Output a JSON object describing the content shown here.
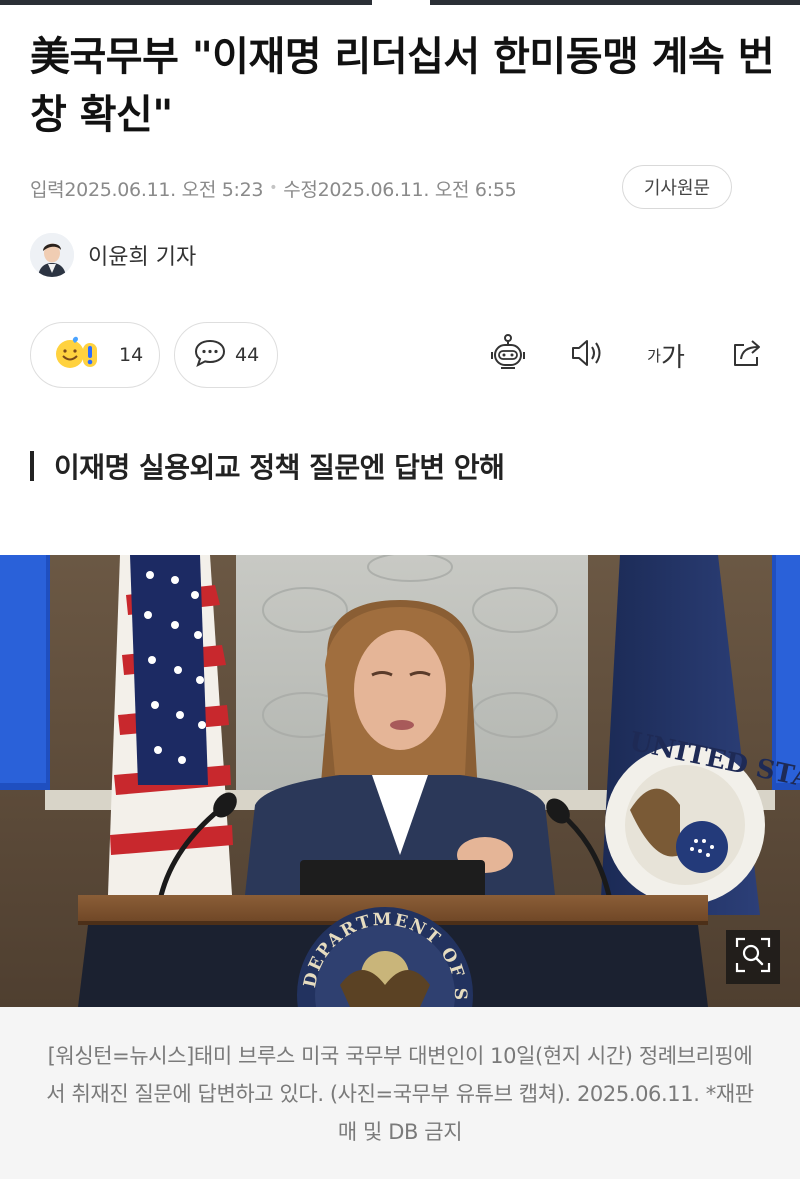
{
  "article": {
    "headline": "美국무부 \"이재명 리더십서 한미동맹 계속 번창 확신\"",
    "input_label": "입력",
    "input_datetime": "2025.06.11. 오전 5:23",
    "modified_label": "수정",
    "modified_datetime": "2025.06.11. 오전 6:55",
    "original_button": "기사원문",
    "reporter": "이윤희 기자",
    "subheadline": "이재명 실용외교 정책 질문엔 답변 안해",
    "caption": "[워싱턴=뉴시스]태미 브루스 미국 국무부 대변인이 10일(현지 시간) 정례브리핑에서 취재진 질문에 답변하고 있다. (사진=국무부 유튜브 캡쳐). 2025.06.11. *재판매 및 DB 금지"
  },
  "engagement": {
    "reaction_count": "14",
    "comment_count": "44"
  },
  "toolbar": {
    "font_size_small": "가",
    "font_size_large": "가",
    "icons": [
      "robot-summary-icon",
      "speaker-icon",
      "font-size-icon",
      "share-icon"
    ]
  },
  "photo": {
    "seal_text_top": "UNITED STATES",
    "podium_text": "DEPARTMENT OF STATE"
  },
  "colors": {
    "top_bar": "#2b2f36",
    "caption_bg": "#f5f5f5",
    "meta_text": "#8a8a8a"
  }
}
